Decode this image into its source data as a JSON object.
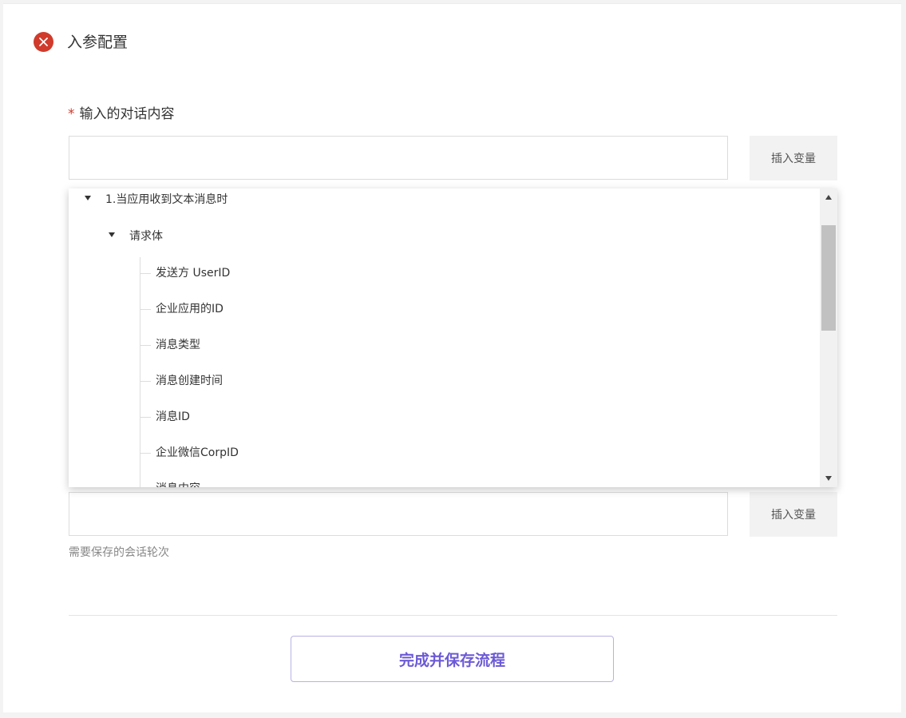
{
  "section": {
    "title": "入参配置",
    "status_icon": "close-circle-icon",
    "status_color": "#d03b2c"
  },
  "field1": {
    "required_mark": "*",
    "label": "输入的对话内容",
    "value": "",
    "insert_label": "插入变量"
  },
  "dropdown": {
    "expand_icon": "caret-down-icon",
    "root": {
      "label": "1.当应用收到文本消息时"
    },
    "group": {
      "label": "请求体"
    },
    "items": [
      {
        "label": "发送方 UserID"
      },
      {
        "label": "企业应用的ID"
      },
      {
        "label": "消息类型"
      },
      {
        "label": "消息创建时间"
      },
      {
        "label": "消息ID"
      },
      {
        "label": "企业微信CorpID"
      },
      {
        "label": "消息内容"
      }
    ]
  },
  "field2": {
    "value": "",
    "insert_label": "插入变量",
    "helper": "需要保存的会话轮次"
  },
  "footer": {
    "save_label": "完成并保存流程",
    "accent": "#6c5ad6"
  }
}
